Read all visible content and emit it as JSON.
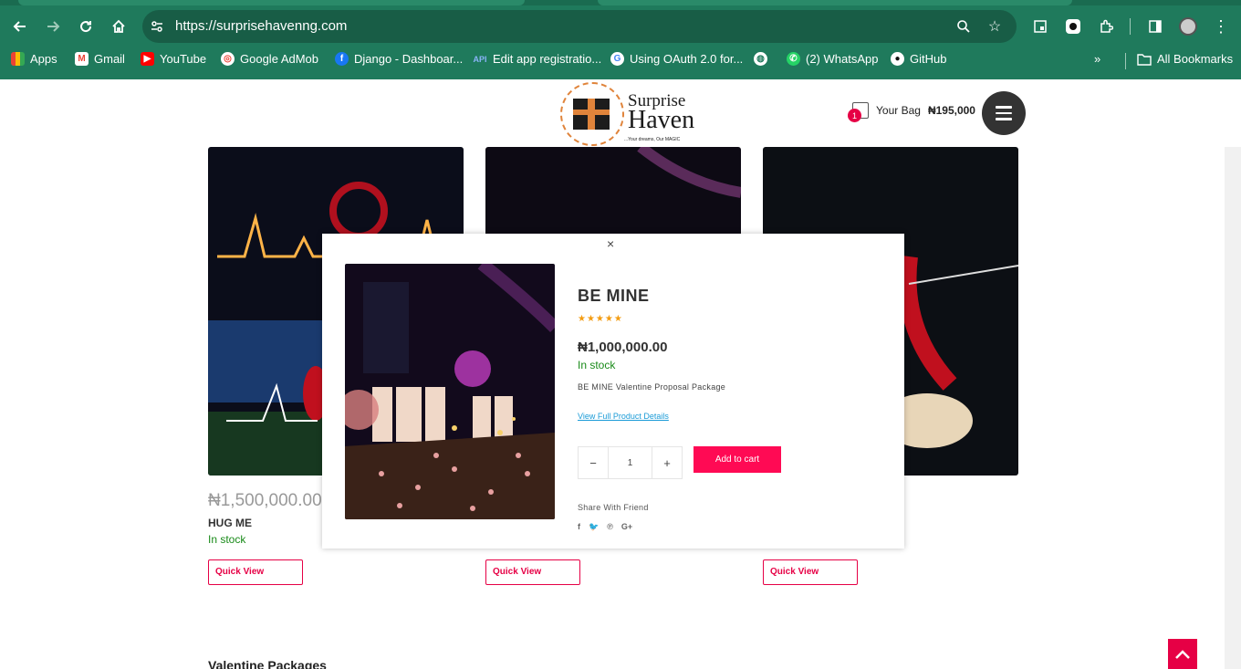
{
  "browser": {
    "url": "https://surprisehavenng.com",
    "bookmarks": [
      {
        "label": "Apps",
        "icon": "apps-grid-icon"
      },
      {
        "label": "Gmail",
        "icon": "gmail-icon"
      },
      {
        "label": "YouTube",
        "icon": "youtube-icon"
      },
      {
        "label": "Google AdMob",
        "icon": "admob-icon"
      },
      {
        "label": "Django - Dashboar...",
        "icon": "facebook-icon"
      },
      {
        "label": "Edit app registratio...",
        "icon": "api-icon"
      },
      {
        "label": "Using OAuth 2.0 for...",
        "icon": "google-icon"
      },
      {
        "label": "",
        "icon": "globe-icon"
      },
      {
        "label": "(2) WhatsApp",
        "icon": "whatsapp-icon"
      },
      {
        "label": "GitHub",
        "icon": "github-icon"
      }
    ],
    "all_bookmarks": "All Bookmarks"
  },
  "header": {
    "logo_line1": "Surprise",
    "logo_line2": "Haven",
    "logo_tagline": "...Your dreams, Our MAGIC",
    "bag_label": "Your Bag",
    "bag_total": "₦195,000",
    "bag_count": "1"
  },
  "products": [
    {
      "price": "₦1,500,000.00",
      "name": "HUG ME",
      "stock": "In stock",
      "quick_view": "Quick View"
    },
    {
      "price": "",
      "name": "",
      "stock": "",
      "quick_view": "Quick View"
    },
    {
      "price": "",
      "name": "",
      "stock": "",
      "quick_view": "Quick View"
    }
  ],
  "section_title": "Valentine Packages",
  "modal": {
    "close": "×",
    "title": "BE MINE",
    "rating_stars": "★★★★★",
    "price": "₦1,000,000.00",
    "stock": "In stock",
    "description": "BE MINE Valentine Proposal Package",
    "details_link": "View Full Product Details",
    "qty_minus": "−",
    "qty_value": "1",
    "qty_plus": "+",
    "add_to_cart": "Add to cart",
    "share_label": "Share With Friend"
  },
  "colors": {
    "browser_bar": "#1f7a5c",
    "accent": "#ff0a54",
    "stock_green": "#188a18",
    "star": "#f39c12",
    "link": "#1a9bd7"
  }
}
